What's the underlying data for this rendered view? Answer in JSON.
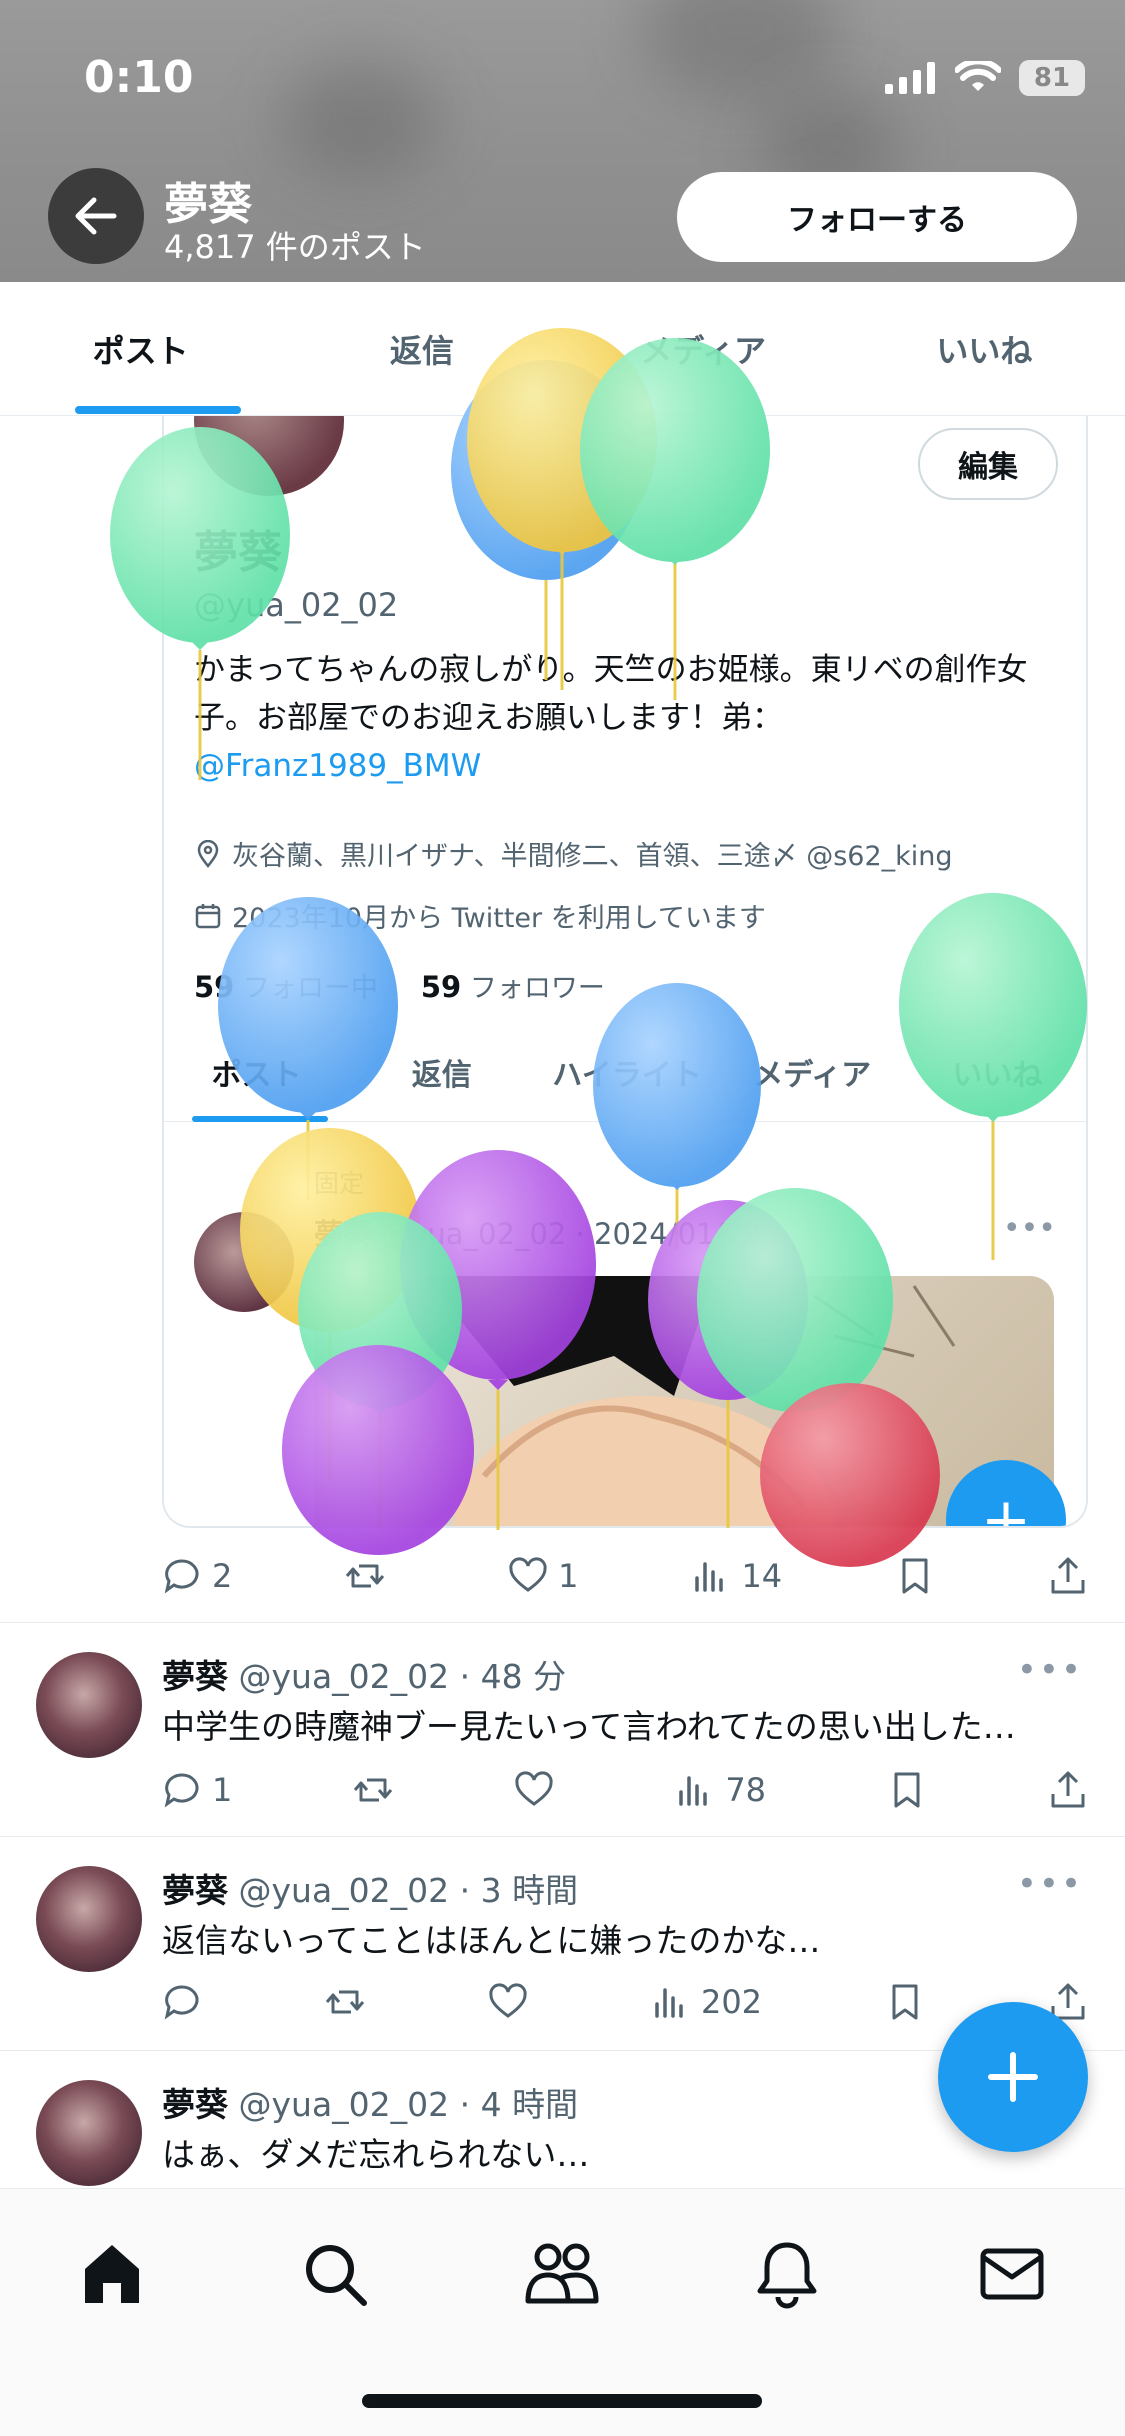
{
  "status_bar": {
    "time": "0:10",
    "battery": "81"
  },
  "header": {
    "name": "夢葵",
    "post_count": "4,817 件のポスト",
    "follow_label": "フォローする"
  },
  "tabs": [
    {
      "label": "ポスト",
      "active": true
    },
    {
      "label": "返信",
      "active": false
    },
    {
      "label": "メディア",
      "active": false
    },
    {
      "label": "いいね",
      "active": false
    }
  ],
  "embedded_profile": {
    "edit_label": "編集",
    "name": "夢葵",
    "handle": "@yua_02_02",
    "bio": "かまってちゃんの寂しがり。天竺のお姫様。東リベの創作女子。お部屋でのお迎えお願いします！弟：",
    "bio_link": "@Franz1989_BMW",
    "location": "灰谷蘭、黒川イザナ、半間修二、首領、三途〆 @s62_king",
    "joined": "2023年10月から Twitter を利用しています",
    "following_count": "59",
    "following_label": "フォロー中",
    "followers_count": "59",
    "followers_label": "フォロワー",
    "tabs": [
      "ポスト",
      "返信",
      "ハイライト",
      "メディア",
      "いいね"
    ],
    "pinned_label": "固定",
    "pinned_name": "夢葵",
    "pinned_meta": "@yua_02_02 · 2024/01/23"
  },
  "pinned_actions": {
    "replies": "2",
    "reposts": "",
    "likes": "1",
    "views": "14"
  },
  "tweets": [
    {
      "name": "夢葵",
      "meta": "@yua_02_02 · 48 分",
      "text": "中学生の時魔神ブー見たいって言われてたの思い出した…",
      "replies": "1",
      "likes": "",
      "views": "78"
    },
    {
      "name": "夢葵",
      "meta": "@yua_02_02 · 3 時間",
      "text": "返信ないってことはほんとに嫌ったのかな…",
      "replies": "",
      "likes": "",
      "views": "202"
    },
    {
      "name": "夢葵",
      "meta": "@yua_02_02 · 4 時間",
      "text": "はぁ、ダメだ忘れられない…"
    }
  ],
  "more_label": "•••",
  "nav": [
    "home-icon",
    "search-icon",
    "communities-icon",
    "bell-icon",
    "mail-icon"
  ],
  "colors": {
    "accent": "#1d9bf0",
    "text": "#0f1419",
    "secondary": "#536471"
  }
}
